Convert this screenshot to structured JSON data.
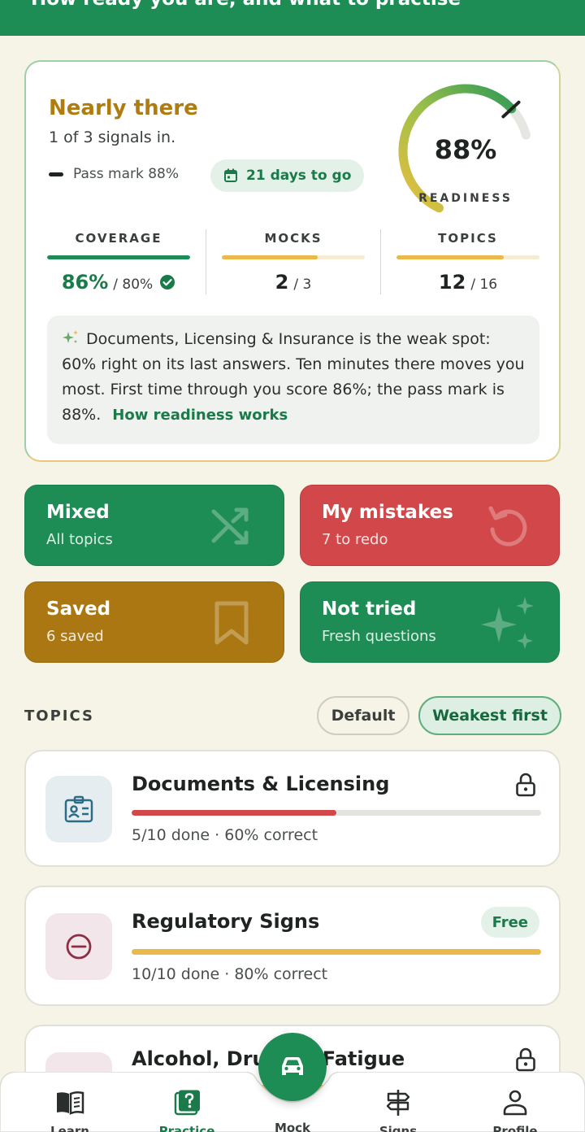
{
  "header": {
    "subtitle": "How ready you are, and what to practise"
  },
  "readiness": {
    "status": "Nearly there",
    "signals": "1 of 3 signals in.",
    "pass_mark_label": "Pass mark 88%",
    "days_left": "21 days to go",
    "gauge_value": "88%",
    "gauge_label": "READINESS",
    "gauge_fraction": 0.88,
    "pass_mark_fraction": 0.88
  },
  "stats": [
    {
      "label": "COVERAGE",
      "value": "86%",
      "total": "/ 80%",
      "fill": 1.0,
      "color": "#1e8c55",
      "met": true
    },
    {
      "label": "MOCKS",
      "value": "2",
      "total": "/ 3",
      "fill": 0.67,
      "color": "#e9b949",
      "met": false
    },
    {
      "label": "TOPICS",
      "value": "12",
      "total": "/ 16",
      "fill": 0.75,
      "color": "#e9b949",
      "met": false
    }
  ],
  "insight": {
    "text": "Documents, Licensing & Insurance is the weak spot: 60% right on its last answers. Ten minutes there moves you most. First time through you score 86%; the pass mark is 88%.",
    "link": "How readiness works"
  },
  "tiles": [
    {
      "title": "Mixed",
      "sub": "All topics",
      "icon": "shuffle-icon",
      "color": "#1e8c55"
    },
    {
      "title": "My mistakes",
      "sub": "7 to redo",
      "icon": "redo-icon",
      "color": "#d2484a"
    },
    {
      "title": "Saved",
      "sub": "6 saved",
      "icon": "bookmark-icon",
      "color": "#ab7712"
    },
    {
      "title": "Not tried",
      "sub": "Fresh questions",
      "icon": "sparkle-icon",
      "color": "#1e8c55"
    }
  ],
  "topics": {
    "heading": "TOPICS",
    "sort_default": "Default",
    "sort_weakest": "Weakest first",
    "items": [
      {
        "name": "Documents & Licensing",
        "meta": "5/10 done · 60% correct",
        "progress": 0.5,
        "bar_color": "#d2484a",
        "locked": true,
        "badge": ""
      },
      {
        "name": "Regulatory Signs",
        "meta": "10/10 done · 80% correct",
        "progress": 1.0,
        "bar_color": "#e9b949",
        "locked": false,
        "badge": "Free"
      },
      {
        "name": "Alcohol, Drugs & Fatigue",
        "meta": "",
        "progress": 1.0,
        "bar_color": "#e9b949",
        "locked": true,
        "badge": ""
      }
    ]
  },
  "nav": [
    {
      "label": "Learn",
      "icon": "book-icon"
    },
    {
      "label": "Practice",
      "icon": "question-icon"
    },
    {
      "label": "Mock",
      "icon": "car-icon"
    },
    {
      "label": "Signs",
      "icon": "signpost-icon"
    },
    {
      "label": "Profile",
      "icon": "person-icon"
    }
  ]
}
